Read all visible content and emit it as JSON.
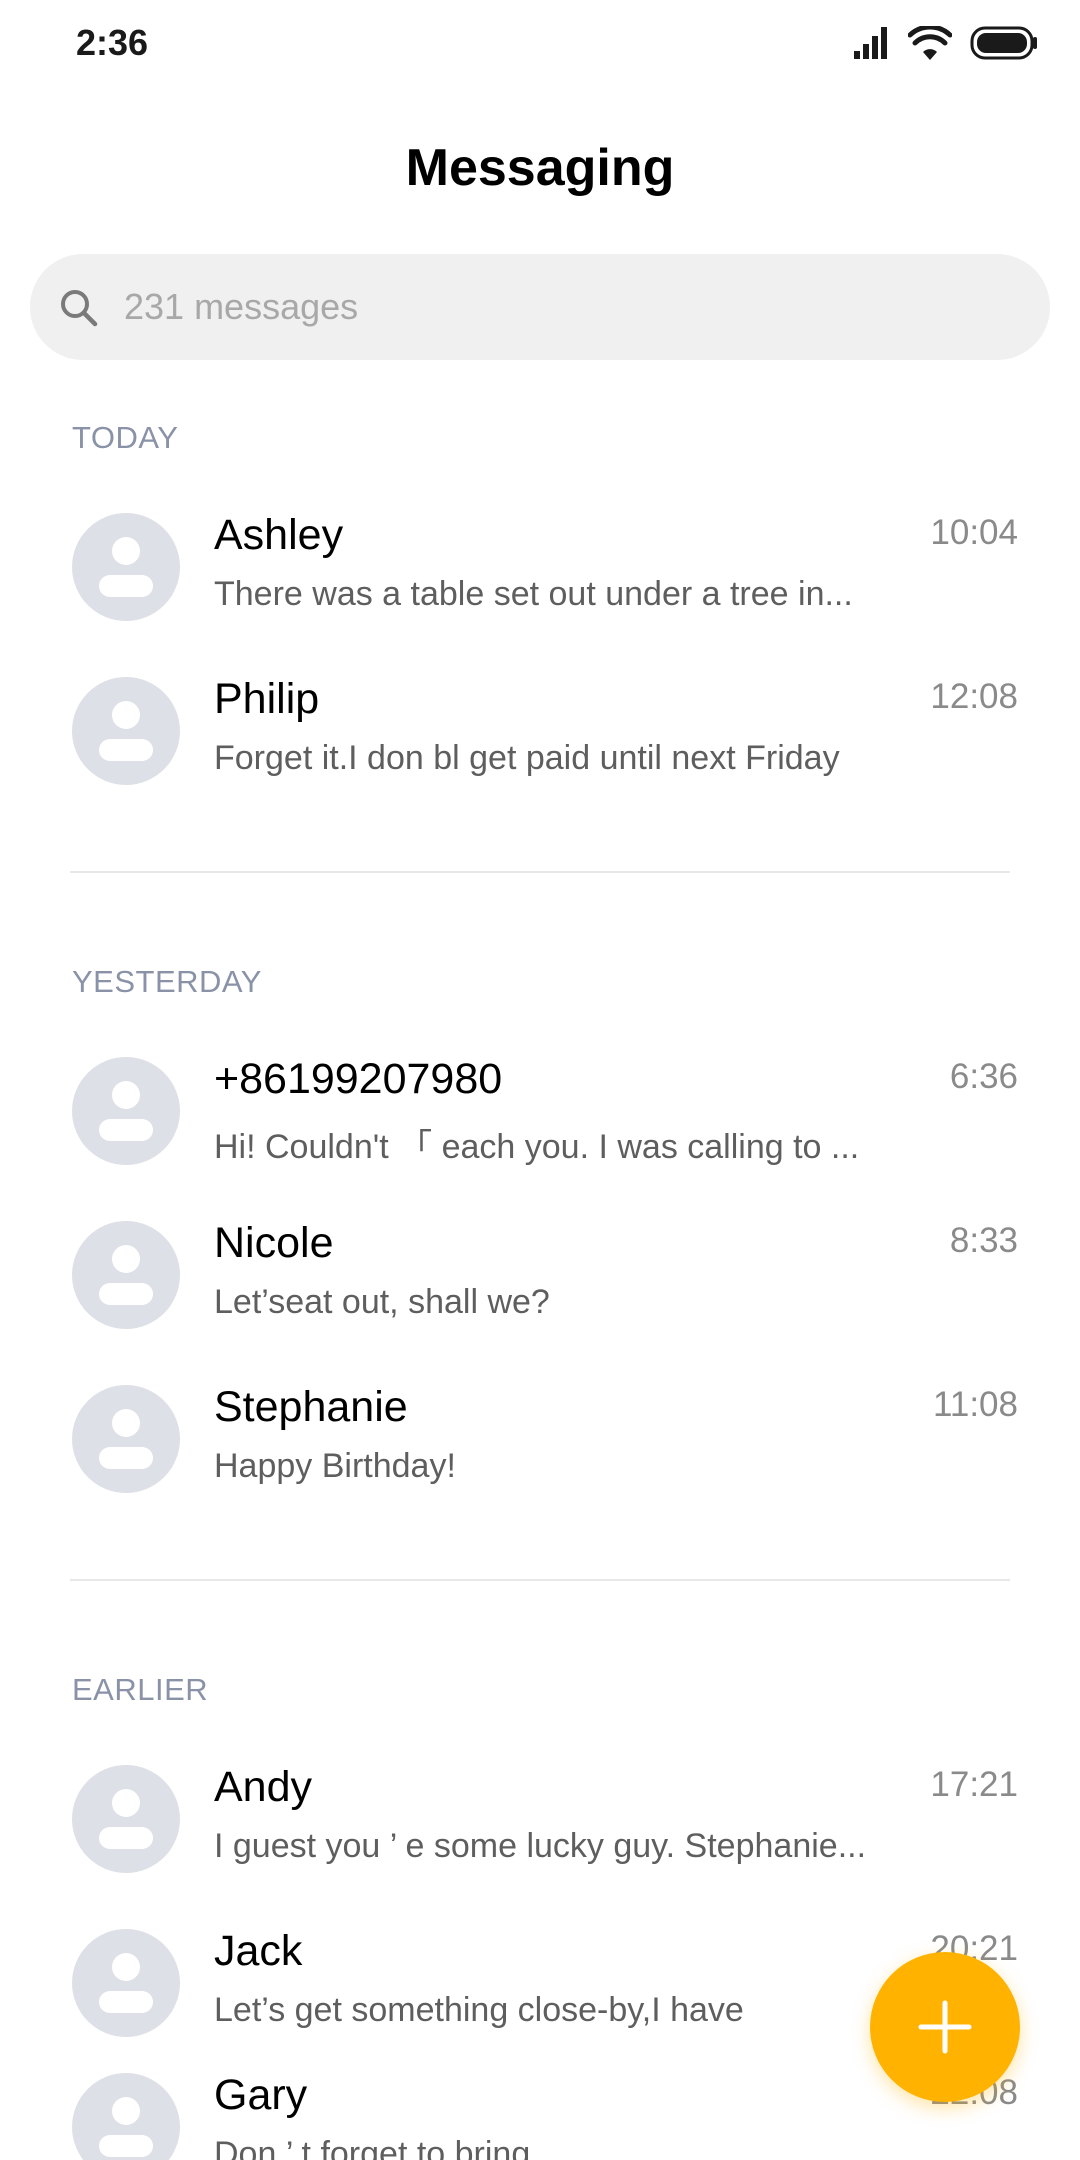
{
  "status_bar": {
    "time": "2:36",
    "icons": [
      "signal-icon",
      "wifi-icon",
      "battery-icon"
    ]
  },
  "header": {
    "title": "Messaging"
  },
  "search": {
    "placeholder": "231 messages",
    "icon": "search-icon"
  },
  "sections": [
    {
      "label": "TODAY",
      "conversations": [
        {
          "name": "Ashley",
          "preview": "There was a table set out under a tree in...",
          "time": "10:04"
        },
        {
          "name": "Philip",
          "preview": "Forget it.I don bl get paid until next Friday",
          "time": "12:08"
        }
      ]
    },
    {
      "label": "YESTERDAY",
      "conversations": [
        {
          "name": "+86199207980",
          "preview": "Hi! Couldn't 「 each you. I was calling to ...",
          "time": "6:36"
        },
        {
          "name": "Nicole",
          "preview": "Let’seat out, shall we?",
          "time": "8:33"
        },
        {
          "name": "Stephanie",
          "preview": "Happy Birthday!",
          "time": "11:08"
        }
      ]
    },
    {
      "label": "EARLIER",
      "conversations": [
        {
          "name": "Andy",
          "preview": "I guest you ’ e some lucky guy. Stephanie...",
          "time": "17:21"
        },
        {
          "name": "Jack",
          "preview": "Let’s get something close-by,I have",
          "time": "20:21"
        },
        {
          "name": "Gary",
          "preview": "Don ’ t forget to bring",
          "time": "22:08"
        }
      ]
    }
  ],
  "fab": {
    "icon": "plus-icon",
    "color": "#ffb300"
  },
  "colors": {
    "accent": "#ffb300",
    "section_header": "#8a92a8",
    "avatar_bg": "#dde0e6",
    "search_bg": "#f0f0f0"
  }
}
